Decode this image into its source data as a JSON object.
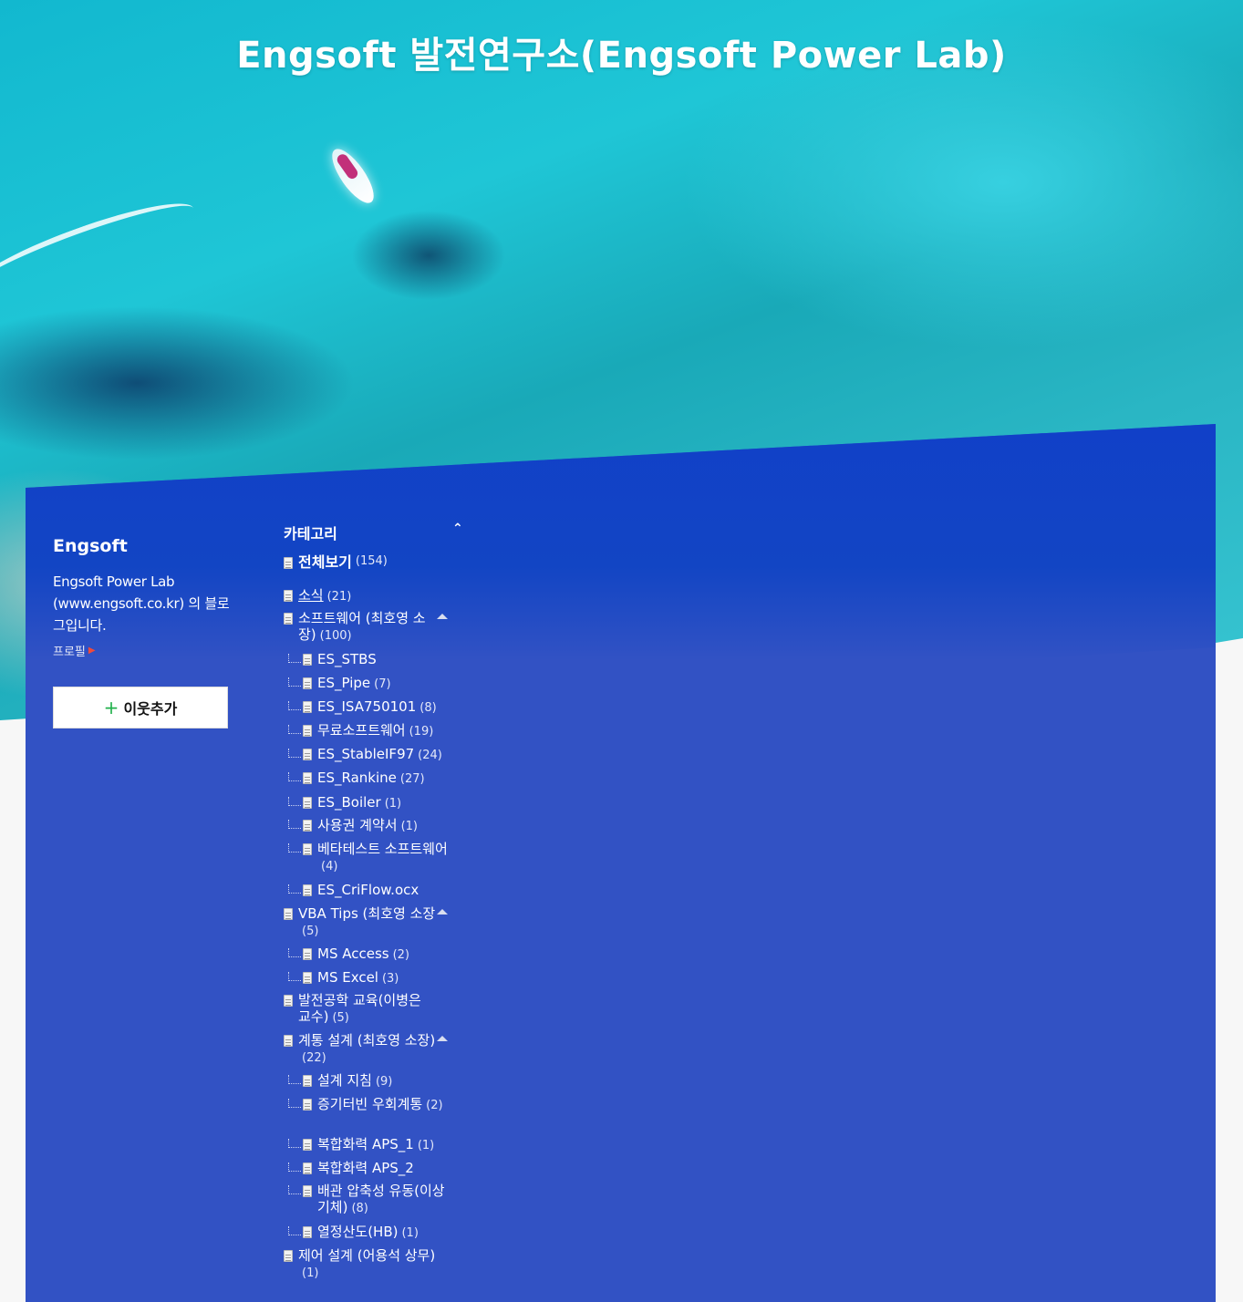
{
  "blog": {
    "title": "Engsoft 발전연구소(Engsoft Power Lab)"
  },
  "profile": {
    "name": "Engsoft",
    "description": "Engsoft Power Lab (www.engsoft.co.kr) 의 블로그입니다.",
    "profile_link": "프로필",
    "follow_button": "이웃추가"
  },
  "category": {
    "heading": "카테고리",
    "all": {
      "label": "전체보기",
      "count": "(154)"
    },
    "items": [
      {
        "label": "소식",
        "count": "(21)",
        "level": 0
      },
      {
        "label": "소프트웨어 (최호영 소장)",
        "count": "(100)",
        "level": 0,
        "expanded": true
      },
      {
        "label": "ES_STBS",
        "count": "",
        "level": 1
      },
      {
        "label": "ES_Pipe",
        "count": "(7)",
        "level": 1
      },
      {
        "label": "ES_ISA750101",
        "count": "(8)",
        "level": 1
      },
      {
        "label": "무료소프트웨어",
        "count": "(19)",
        "level": 1
      },
      {
        "label": "ES_StableIF97",
        "count": "(24)",
        "level": 1
      },
      {
        "label": "ES_Rankine",
        "count": "(27)",
        "level": 1
      },
      {
        "label": "ES_Boiler",
        "count": "(1)",
        "level": 1
      },
      {
        "label": "사용권 계약서",
        "count": "(1)",
        "level": 1
      },
      {
        "label": "베타테스트 소프트웨어",
        "count": "(4)",
        "level": 1
      },
      {
        "label": "ES_CriFlow.ocx",
        "count": "",
        "level": 1
      },
      {
        "label": "VBA Tips (최호영 소장",
        "count": "(5)",
        "level": 0,
        "expanded": true
      },
      {
        "label": "MS Access",
        "count": "(2)",
        "level": 1
      },
      {
        "label": "MS Excel",
        "count": "(3)",
        "level": 1
      },
      {
        "label": "발전공학 교육(이병은 교수)",
        "count": "(5)",
        "level": 0
      },
      {
        "label": "계통 설계 (최호영 소장)",
        "count": "(22)",
        "level": 0,
        "expanded": true
      },
      {
        "label": "설계 지침",
        "count": "(9)",
        "level": 1
      },
      {
        "label": "증기터빈 우회계통",
        "count": "(2)",
        "level": 1
      },
      {
        "label": "복합화력 APS_1",
        "count": "(1)",
        "level": 1
      },
      {
        "label": "복합화력 APS_2",
        "count": "",
        "level": 1
      },
      {
        "label": "배관 압축성 유동(이상 기체)",
        "count": "(8)",
        "level": 1
      },
      {
        "label": "열정산도(HB)",
        "count": "(1)",
        "level": 1
      },
      {
        "label": "제어 설계 (어용석 상무)",
        "count": "(1)",
        "level": 0
      }
    ]
  },
  "colors": {
    "panel": "#3252c4",
    "accent_plus": "#22b14c",
    "profile_arrow": "#f04a3a"
  }
}
